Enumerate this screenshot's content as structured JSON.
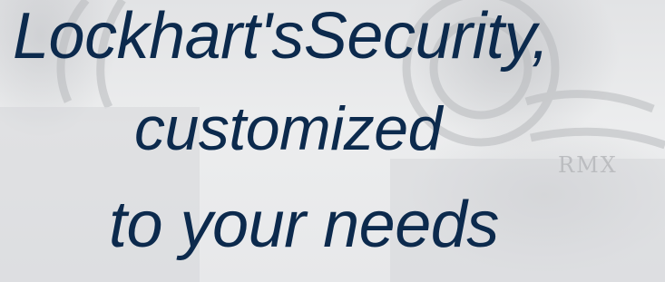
{
  "hero": {
    "headline_line_1": "Lockhart'sSecurity,",
    "headline_line_2": "customized",
    "headline_line_3": "to your needs",
    "background_text": "RMX",
    "text_color": "#0c2a4d",
    "background_color": "#e6e7e9"
  }
}
